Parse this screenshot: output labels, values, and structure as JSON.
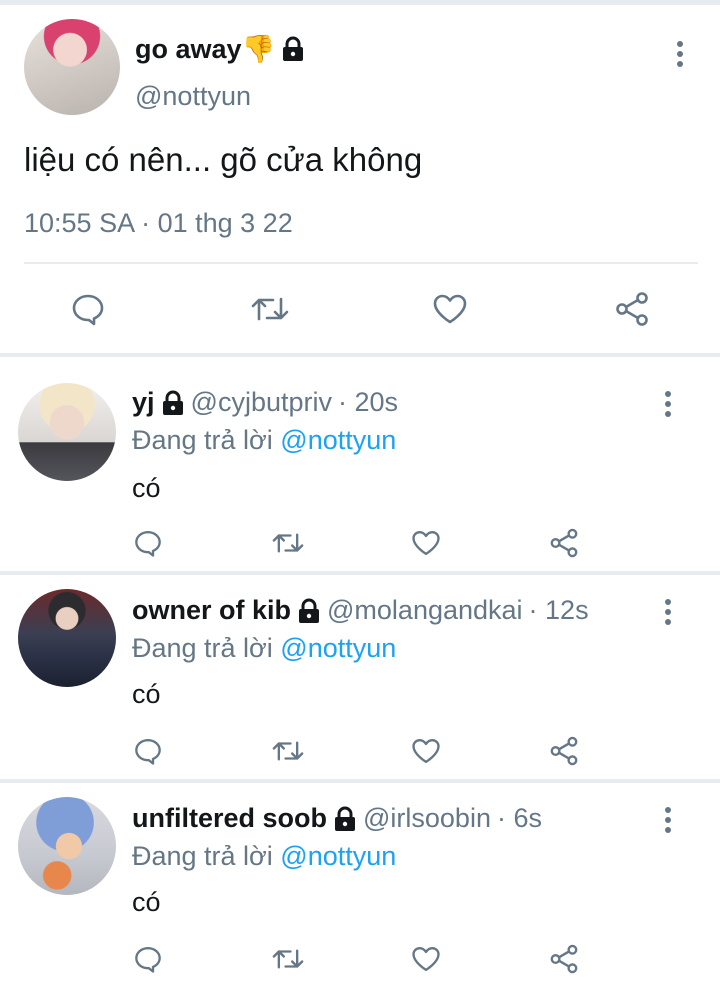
{
  "main_tweet": {
    "display_name": "go away",
    "name_emoji": "👎",
    "handle": "@nottyun",
    "text": "liệu có nên... gõ cửa không",
    "time": "10:55 SA · 01 thg 3 22"
  },
  "replies": [
    {
      "display_name": "yj",
      "handle": "@cyjbutpriv",
      "age": "· 20s",
      "reply_label": "Đang trả lời",
      "reply_to": "@nottyun",
      "text": "có"
    },
    {
      "display_name": "owner of kib",
      "handle": "@molangandkai",
      "age": "· 12s",
      "reply_label": "Đang trả lời",
      "reply_to": "@nottyun",
      "text": "có"
    },
    {
      "display_name": "unfiltered soob",
      "handle": "@irlsoobin",
      "age": "· 6s",
      "reply_label": "Đang trả lời",
      "reply_to": "@nottyun",
      "text": "có"
    }
  ],
  "icons": {
    "reply": "comment-icon",
    "retweet": "retweet-icon",
    "like": "heart-icon",
    "share": "share-icon",
    "protected": "lock-icon",
    "menu": "more-vertical-icon"
  },
  "colors": {
    "text": "#14171a",
    "secondary": "#657786",
    "mention": "#1da1f2",
    "divider": "#e6ecf0"
  }
}
